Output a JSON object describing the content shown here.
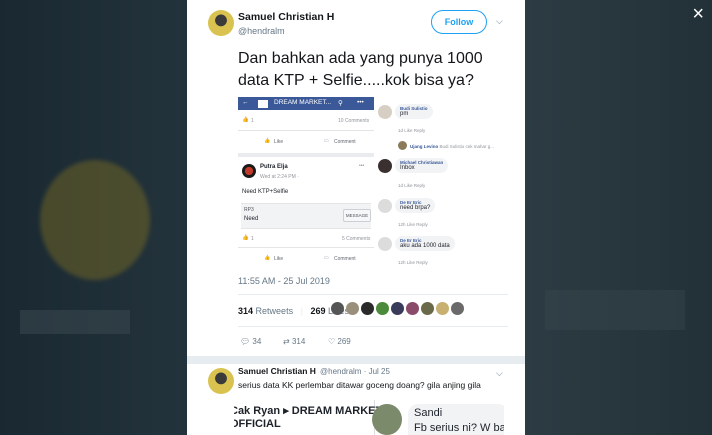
{
  "tweet": {
    "author_name": "Samuel Christian H",
    "author_handle": "@hendralm",
    "follow_label": "Follow",
    "text": "Dan bahkan ada yang punya 1000 data KTP + Selfie.....kok bisa ya?",
    "timestamp": "11:55 AM - 25 Jul 2019",
    "retweets_count": "314",
    "retweets_label": "Retweets",
    "likes_count": "269",
    "likes_label": "Likes",
    "reply_count": "34",
    "retweet_action_count": "314",
    "like_action_count": "269"
  },
  "screenshot": {
    "group_name": "DREAM MARKET...",
    "reaction_count": "1",
    "comments_count": "10 Comments",
    "like_label": "Like",
    "comment_label": "Comment",
    "post_author": "Putra Elja",
    "post_time": "Wed at 2:24 PM · ",
    "post_text": "Need KTP+Selfie",
    "rp_label": "RP3",
    "need_label": "Need",
    "message_label": "MESSAGE",
    "reaction_count2": "1",
    "comments_count2": "5 Comments",
    "like_label2": "Like",
    "comment_label2": "Comment",
    "comments": [
      {
        "name": "Budi Sulistio",
        "text": "pm",
        "meta": "1d   Like   Reply"
      },
      {
        "name": "Ujang Levino",
        "text": "Budi Sulistio cek mahar g..."
      },
      {
        "name": "Michael Christiawan",
        "text": "Inbox",
        "meta": "1d   Like   Reply"
      },
      {
        "name": "De Er Eric",
        "text": "need brpa?",
        "meta": "12h   Like   Reply"
      },
      {
        "name": "De Er Eric",
        "text": "aku ada 1000 data",
        "meta": "12h   Like   Reply"
      }
    ]
  },
  "reply": {
    "author_name": "Samuel Christian H",
    "author_handle": "@hendralm · Jul 25",
    "text": "serius data KK perlembar ditawar goceng doang? gila anjing gila",
    "image_title1": "Cak Ryan ▸ DREAM MARKET",
    "image_title2": "OFFICIAL",
    "image_right_name": "Sandi",
    "image_right_text": "Fb serius ni? W ba"
  },
  "colors": {
    "accent": "#1da1f2",
    "facebook_blue": "#3b5998"
  }
}
